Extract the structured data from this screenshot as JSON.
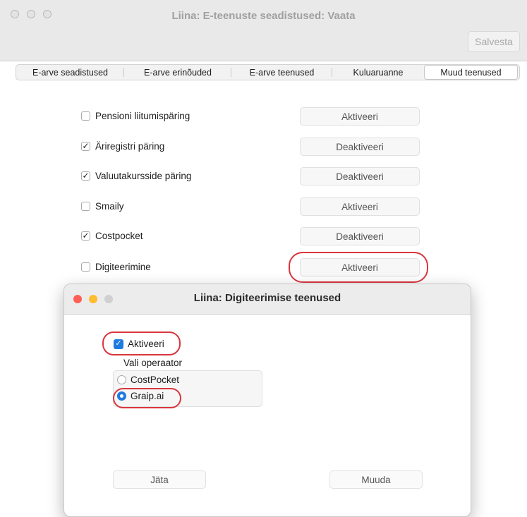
{
  "window": {
    "title": "Liina: E-teenuste seadistused: Vaata",
    "save_label": "Salvesta"
  },
  "tabs": [
    {
      "label": "E-arve seadistused"
    },
    {
      "label": "E-arve erinõuded"
    },
    {
      "label": "E-arve teenused"
    },
    {
      "label": "Kuluaruanne"
    },
    {
      "label": "Muud teenused",
      "active": true
    }
  ],
  "services": [
    {
      "label": "Pensioni liitumispäring",
      "checked": false,
      "button": "Aktiveeri"
    },
    {
      "label": "Äriregistri päring",
      "checked": true,
      "button": "Deaktiveeri"
    },
    {
      "label": "Valuutakursside päring",
      "checked": true,
      "button": "Deaktiveeri"
    },
    {
      "label": "Smaily",
      "checked": false,
      "button": "Aktiveeri"
    },
    {
      "label": "Costpocket",
      "checked": true,
      "button": "Deaktiveeri"
    },
    {
      "label": "Digiteerimine",
      "checked": false,
      "button": "Aktiveeri"
    }
  ],
  "dialog": {
    "title": "Liina: Digiteerimise teenused",
    "activate_label": "Aktiveeri",
    "activate_checked": true,
    "operator_label": "Vali operaator",
    "operators": [
      {
        "label": "CostPocket",
        "selected": false
      },
      {
        "label": "Graip.ai",
        "selected": true
      }
    ],
    "leave_label": "Jäta",
    "change_label": "Muuda"
  },
  "colors": {
    "highlight": "#d9363e",
    "accent": "#1f7ae0",
    "close": "#fe5f57",
    "minimize": "#febc2e",
    "zoom_inactive": "#d0d0d0"
  }
}
